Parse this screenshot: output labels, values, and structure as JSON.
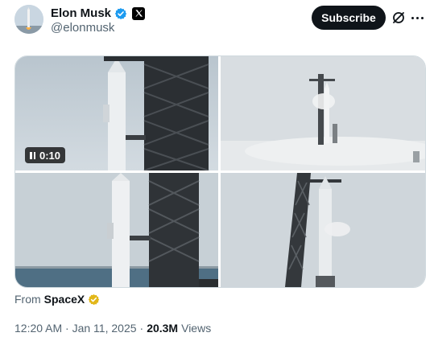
{
  "author": {
    "display_name": "Elon Musk",
    "handle": "@elonmusk",
    "verified_color": "#1d9bf0"
  },
  "actions": {
    "subscribe_label": "Subscribe",
    "grok_icon": "grok-icon",
    "more_icon": "more-icon"
  },
  "media": {
    "video_time": "0:10",
    "tiles": [
      "starship-tower-closeup",
      "starship-venting-fog",
      "starship-tower-ocean",
      "starship-side-view"
    ]
  },
  "source": {
    "from_label": "From",
    "name": "SpaceX",
    "badge_color": "#e2b719"
  },
  "meta": {
    "timestamp": "12:20 AM · Jan 11, 2025",
    "separator": "·",
    "views_count": "20.3M",
    "views_label": "Views"
  }
}
